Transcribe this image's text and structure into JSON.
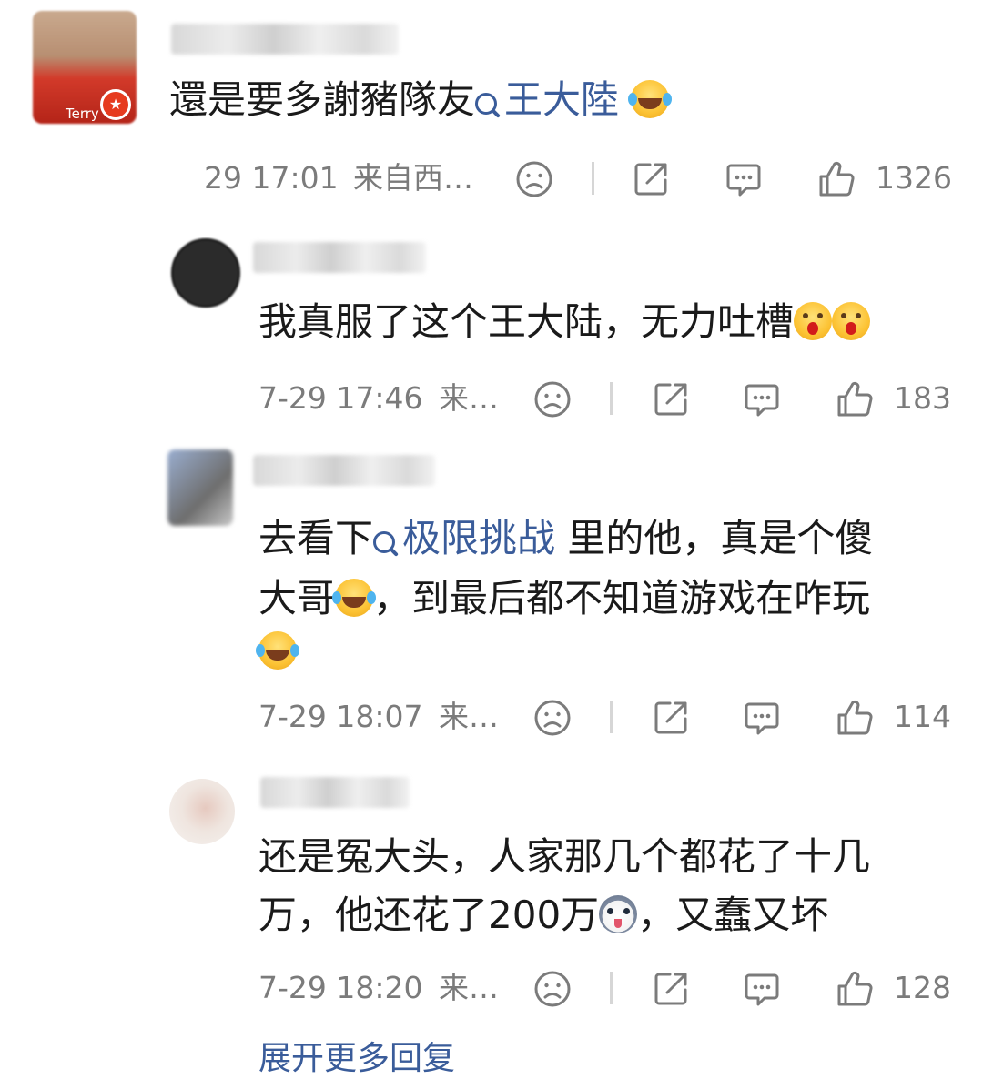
{
  "comments": [
    {
      "text_parts": [
        "還是要多謝豬隊友",
        "王大陸"
      ],
      "time": "29 17:01",
      "location": "来自西…",
      "likes": "1326"
    },
    {
      "text": "我真服了这个王大陆，无力吐槽",
      "time": "7-29 17:46",
      "location": "来…",
      "likes": "183"
    },
    {
      "text_parts": [
        "去看下",
        "极限挑战",
        " 里的他，真是个傻",
        "大哥",
        "，到最后都不知道游戏在咋玩"
      ],
      "time": "7-29 18:07",
      "location": "来…",
      "likes": "114"
    },
    {
      "text_parts": [
        "还是冤大头，人家那几个都花了十几",
        "万，他还花了200万",
        "，又蠢又坏"
      ],
      "time": "7-29 18:20",
      "location": "来…",
      "likes": "128"
    }
  ],
  "avatar_badge_text": "Terry",
  "more_replies": "展开更多回复",
  "icons": [
    "dislike-icon",
    "share-icon",
    "comment-icon",
    "like-icon",
    "search-topic-icon",
    "verified-badge-icon"
  ],
  "colors": {
    "topic": "#3a5c9a",
    "meta": "#7b7b7b",
    "badge": "#e63b1f"
  }
}
